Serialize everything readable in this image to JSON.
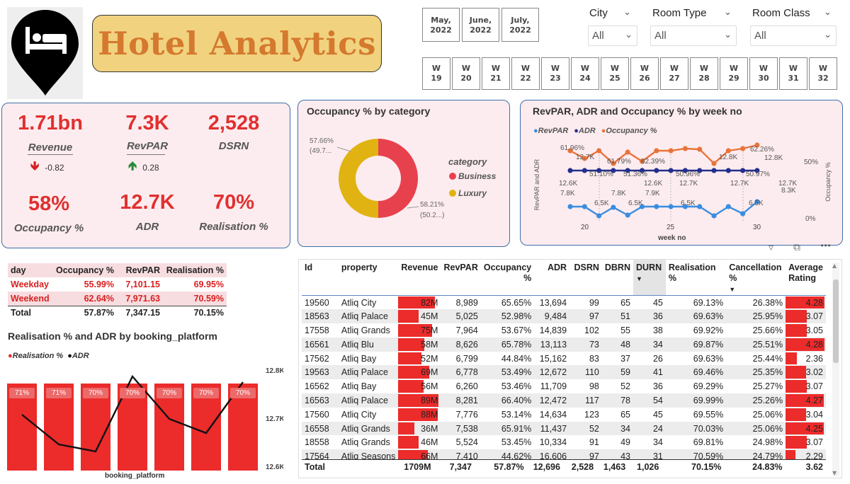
{
  "header": {
    "title": "Hotel Analytics",
    "logo_icon": "hotel-bed-pin-icon",
    "months": [
      "May,\n2022",
      "June,\n2022",
      "July,\n2022"
    ],
    "weeks": [
      "W\n19",
      "W\n20",
      "W\n21",
      "W\n22",
      "W\n23",
      "W\n24",
      "W\n25",
      "W\n26",
      "W\n27",
      "W\n28",
      "W\n29",
      "W\n30",
      "W\n31",
      "W\n32"
    ],
    "slicers": [
      {
        "label": "City",
        "value": "All"
      },
      {
        "label": "Room Type",
        "value": "All"
      },
      {
        "label": "Room Class",
        "value": "All"
      }
    ]
  },
  "kpis": {
    "revenue": {
      "value": "1.71bn",
      "label": "Revenue",
      "delta": "-0.82"
    },
    "revpar": {
      "value": "7.3K",
      "label": "RevPAR",
      "delta": "0.28"
    },
    "dsrn": {
      "value": "2,528",
      "label": "DSRN"
    },
    "occupancy": {
      "value": "58%",
      "label": "Occupancy %"
    },
    "adr": {
      "value": "12.7K",
      "label": "ADR"
    },
    "realisation": {
      "value": "70%",
      "label": "Realisation %"
    }
  },
  "occupancy_by_category": {
    "title": "Occupancy % by category",
    "legend_title": "category",
    "labels": [
      "57.66%",
      "(49.7...",
      "58.21%",
      "(50.2...)"
    ],
    "categories": [
      {
        "name": "Business",
        "color": "#e8414e"
      },
      {
        "name": "Luxury",
        "color": "#e0b313"
      }
    ]
  },
  "weekly_chart": {
    "title": "RevPAR, ADR and Occupancy % by week no",
    "legend": [
      {
        "name": "RevPAR",
        "color": "#3a8de0"
      },
      {
        "name": "ADR",
        "color": "#232f8c"
      },
      {
        "name": "Occupancy %",
        "color": "#e8743b"
      }
    ],
    "ylabel_left": "RevPAR and ADR",
    "ylabel_right": "Occupancy %",
    "xlabel": "week no",
    "xticks": [
      "20",
      "25",
      "30"
    ],
    "right_ticks": [
      "50%",
      "0%"
    ],
    "annotations": [
      "61.96%",
      "12.7K",
      "51.10%",
      "61.79%",
      "51.36%",
      "62.39%",
      "50.96%",
      "12.8K",
      "62.26%",
      "12.8K",
      "50.97%",
      "12.6K",
      "7.8K",
      "6.5K",
      "7.8K",
      "6.5K",
      "12.6K",
      "7.9K",
      "12.7K",
      "6.5K",
      "12.7K",
      "6.5K",
      "12.7K",
      "8.3K"
    ]
  },
  "day_table": {
    "headers": [
      "day",
      "Occupancy %",
      "RevPAR",
      "Realisation %"
    ],
    "rows": [
      [
        "Weekday",
        "55.99%",
        "7,101.15",
        "69.95%"
      ],
      [
        "Weekend",
        "62.64%",
        "7,971.63",
        "70.59%"
      ]
    ],
    "total": [
      "Total",
      "57.87%",
      "7,347.15",
      "70.15%"
    ]
  },
  "platform_chart": {
    "title": "Realisation % and ADR by booking_platform",
    "legend": [
      {
        "name": "Realisation %",
        "color": "#e82a2a"
      },
      {
        "name": "ADR",
        "color": "#111111"
      }
    ],
    "bar_labels": [
      "71%",
      "71%",
      "70%",
      "70%",
      "70%",
      "70%",
      "70%"
    ],
    "right_ticks": [
      "12.8K",
      "12.7K",
      "12.6K"
    ],
    "xlabel": "booking_platform"
  },
  "property_table": {
    "headers": [
      "Id",
      "property",
      "Revenue",
      "RevPAR",
      "Occupancy %",
      "ADR",
      "DSRN",
      "DBRN",
      "DURN",
      "Realisation %",
      "Cancellation %",
      "Average Rating"
    ],
    "rows": [
      [
        "19560",
        "Atliq City",
        "82M",
        "8,989",
        "65.65%",
        "13,694",
        "99",
        "65",
        "45",
        "69.13%",
        "26.38%",
        "4.28"
      ],
      [
        "18563",
        "Atliq Palace",
        "45M",
        "5,025",
        "52.98%",
        "9,484",
        "97",
        "51",
        "36",
        "69.63%",
        "25.95%",
        "3.07"
      ],
      [
        "17558",
        "Atliq Grands",
        "75M",
        "7,964",
        "53.67%",
        "14,839",
        "102",
        "55",
        "38",
        "69.92%",
        "25.66%",
        "3.05"
      ],
      [
        "16561",
        "Atliq Blu",
        "58M",
        "8,626",
        "65.78%",
        "13,113",
        "73",
        "48",
        "34",
        "69.87%",
        "25.51%",
        "4.28"
      ],
      [
        "17562",
        "Atliq Bay",
        "52M",
        "6,799",
        "44.84%",
        "15,162",
        "83",
        "37",
        "26",
        "69.63%",
        "25.44%",
        "2.36"
      ],
      [
        "19563",
        "Atliq Palace",
        "69M",
        "6,778",
        "53.49%",
        "12,672",
        "110",
        "59",
        "41",
        "69.46%",
        "25.35%",
        "3.02"
      ],
      [
        "16562",
        "Atliq Bay",
        "56M",
        "6,260",
        "53.46%",
        "11,709",
        "98",
        "52",
        "36",
        "69.29%",
        "25.27%",
        "3.07"
      ],
      [
        "16563",
        "Atliq Palace",
        "89M",
        "8,281",
        "66.40%",
        "12,472",
        "117",
        "78",
        "54",
        "69.99%",
        "25.26%",
        "4.27"
      ],
      [
        "17560",
        "Atliq City",
        "88M",
        "7,776",
        "53.14%",
        "14,634",
        "123",
        "65",
        "45",
        "69.55%",
        "25.06%",
        "3.04"
      ],
      [
        "16558",
        "Atliq Grands",
        "36M",
        "7,538",
        "65.91%",
        "11,437",
        "52",
        "34",
        "24",
        "70.03%",
        "25.06%",
        "4.25"
      ],
      [
        "18558",
        "Atliq Grands",
        "46M",
        "5,524",
        "53.45%",
        "10,334",
        "91",
        "49",
        "34",
        "69.81%",
        "24.98%",
        "3.07"
      ],
      [
        "17564",
        "Atliq Seasons",
        "66M",
        "7,410",
        "44.62%",
        "16,606",
        "97",
        "43",
        "31",
        "70.59%",
        "24.79%",
        "2.29"
      ]
    ],
    "total": [
      "Total",
      "",
      "1709M",
      "7,347",
      "57.87%",
      "12,696",
      "2,528",
      "1,463",
      "1,026",
      "70.15%",
      "24.83%",
      "3.62"
    ]
  }
}
